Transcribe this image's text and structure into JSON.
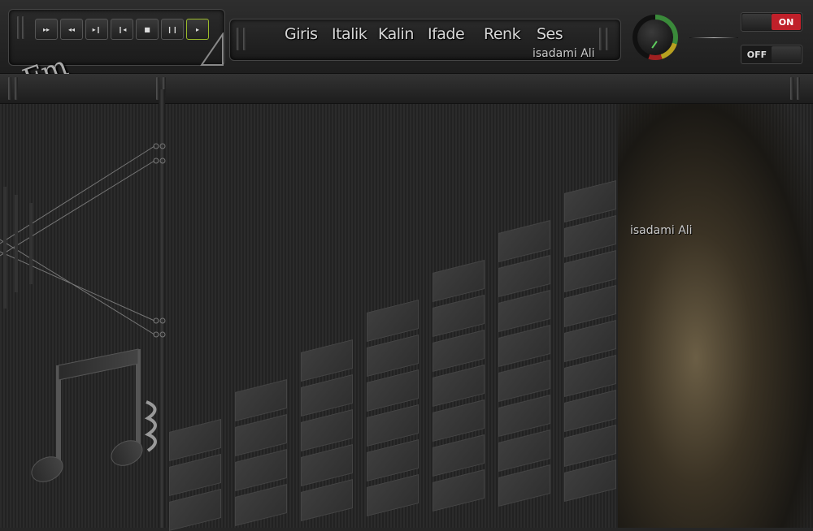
{
  "controls": [
    {
      "glyph": "▸▸",
      "name": "fast-forward"
    },
    {
      "glyph": "◂◂",
      "name": "rewind"
    },
    {
      "glyph": "▸❙",
      "name": "next-track"
    },
    {
      "glyph": "❙◂",
      "name": "previous-track"
    },
    {
      "glyph": "■",
      "name": "stop"
    },
    {
      "glyph": "❙❙",
      "name": "pause"
    },
    {
      "glyph": "▸",
      "name": "play"
    }
  ],
  "nav": [
    "Giris",
    "Italik",
    "Kalin",
    "Ifade",
    "Renk",
    "Ses"
  ],
  "credit": "isadami Ali",
  "logo": "Fm",
  "toggles": {
    "on_label": "ON",
    "off_label": "OFF"
  },
  "colors": {
    "on_red": "#c0202a",
    "accent_green": "#9bbb2a"
  },
  "photo_credit": "isadami Ali"
}
